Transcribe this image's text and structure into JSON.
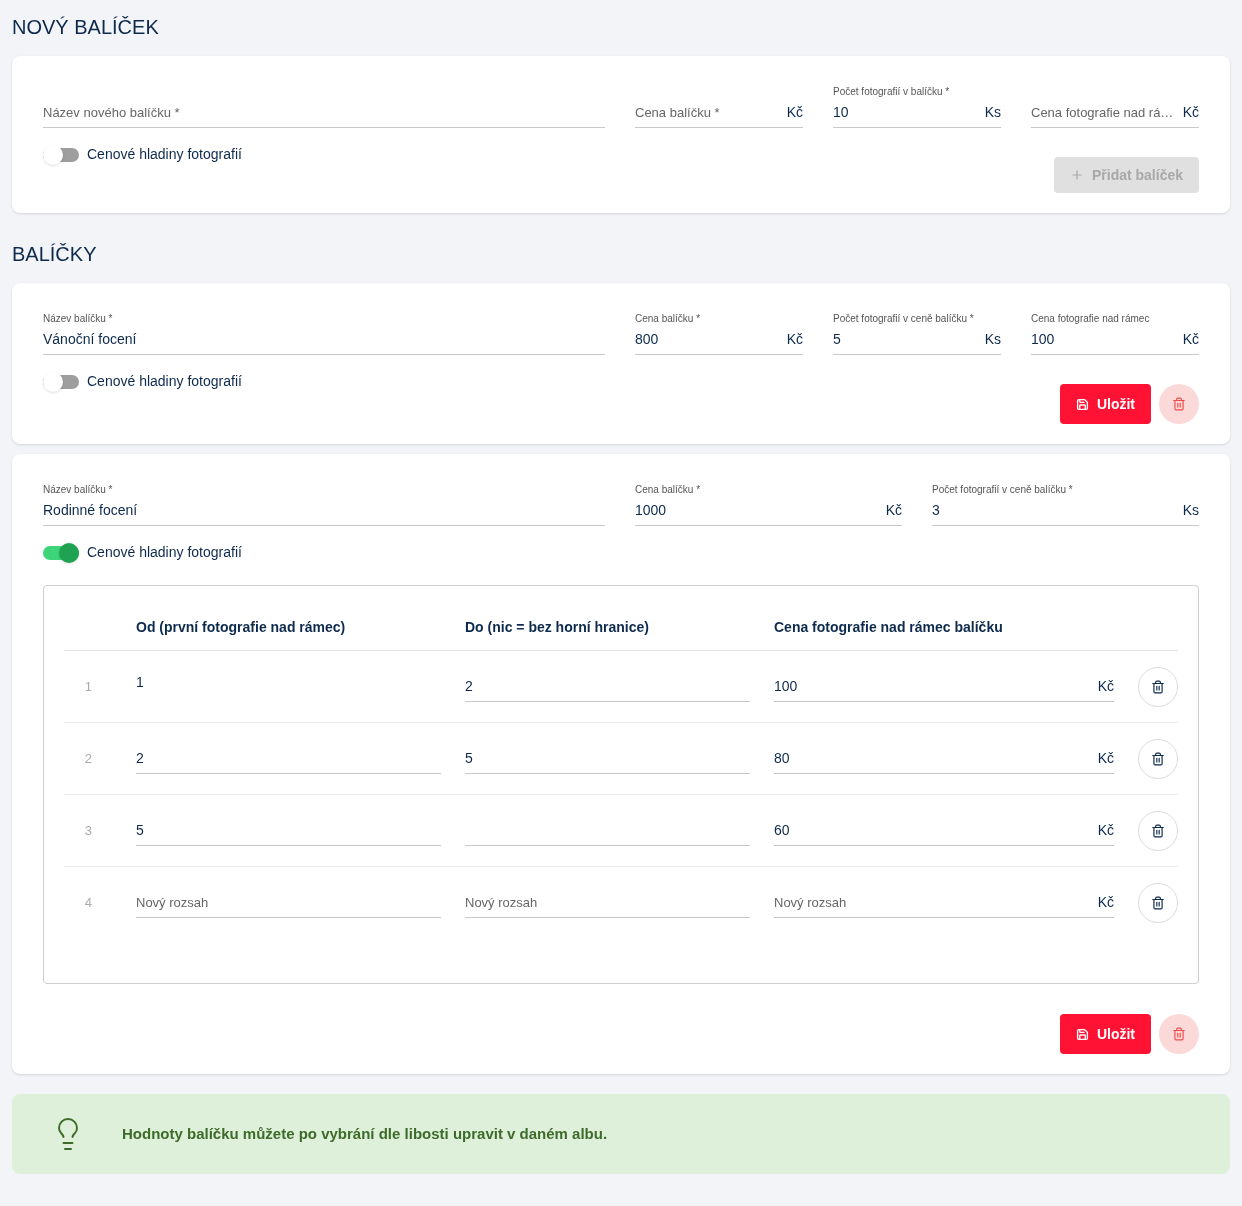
{
  "new_package": {
    "title": "NOVÝ BALÍČEK",
    "fields": [
      {
        "placeholder": "Název nového balíčku *"
      },
      {
        "placeholder": "Cena balíčku *",
        "unit": "Kč"
      },
      {
        "label": "Počet fotografií v balíčku *",
        "value": "10",
        "unit": "Ks"
      },
      {
        "placeholder": "Cena fotografie nad rá…",
        "unit": "Kč"
      }
    ],
    "toggle": {
      "label": "Cenové hladiny fotografií",
      "on": false
    },
    "add_button": {
      "label": "Přidat balíček",
      "disabled": true
    }
  },
  "packages_title": "BALÍČKY",
  "packages": [
    {
      "fields": [
        {
          "label": "Název balíčku *",
          "value": "Vánoční focení"
        },
        {
          "label": "Cena balíčku *",
          "value": "800",
          "unit": "Kč"
        },
        {
          "label": "Počet fotografií v ceně balíčku *",
          "value": "5",
          "unit": "Ks"
        },
        {
          "label": "Cena fotografie nad rámec",
          "value": "100",
          "unit": "Kč"
        }
      ],
      "toggle": {
        "label": "Cenové hladiny fotografií",
        "on": false
      },
      "save_button": "Uložit"
    },
    {
      "fields": [
        {
          "label": "Název balíčku *",
          "value": "Rodinné focení"
        },
        {
          "label": "Cena balíčku *",
          "value": "1000",
          "unit": "Kč"
        },
        {
          "label": "Počet fotografií v ceně balíčku *",
          "value": "3",
          "unit": "Ks"
        }
      ],
      "toggle": {
        "label": "Cenové hladiny fotografií",
        "on": true
      },
      "tiers": {
        "columns": [
          "Od (první fotografie nad rámec)",
          "Do (nic = bez horní hranice)",
          "Cena fotografie nad rámec balíčku"
        ],
        "rows": [
          {
            "number": "1",
            "from": {
              "kind": "text",
              "value": "1"
            },
            "to": {
              "kind": "input",
              "value": "2"
            },
            "price": {
              "kind": "input",
              "value": "100"
            },
            "unit": "Kč"
          },
          {
            "number": "2",
            "from": {
              "kind": "input",
              "value": "2"
            },
            "to": {
              "kind": "input",
              "value": "5"
            },
            "price": {
              "kind": "input",
              "value": "80"
            },
            "unit": "Kč"
          },
          {
            "number": "3",
            "from": {
              "kind": "input",
              "value": "5"
            },
            "to": {
              "kind": "input"
            },
            "price": {
              "kind": "input",
              "value": "60"
            },
            "unit": "Kč"
          },
          {
            "number": "4",
            "from": {
              "kind": "input",
              "placeholder": "Nový rozsah"
            },
            "to": {
              "kind": "input",
              "placeholder": "Nový rozsah"
            },
            "price": {
              "kind": "input",
              "placeholder": "Nový rozsah"
            },
            "unit": "Kč"
          }
        ]
      },
      "save_button": "Uložit"
    }
  ],
  "tip": "Hodnoty balíčku můžete po vybrání dle libosti upravit v daném albu."
}
